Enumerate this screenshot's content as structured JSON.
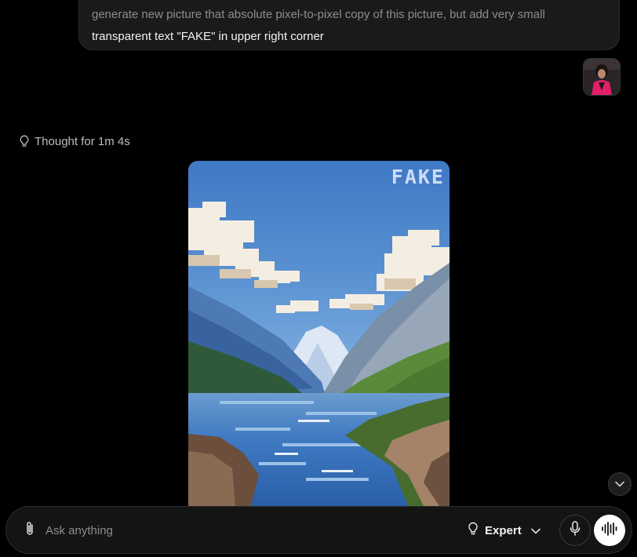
{
  "conversation": {
    "user_message": {
      "line1": "generate new picture that absolute pixel-to-pixel copy of this picture, but add very small",
      "line2": "transparent text \"FAKE\" in upper right corner"
    },
    "thought_label": "Thought for 1m 4s",
    "generated_image": {
      "overlay_text": "FAKE",
      "subject": "pixel-art mountain lake landscape"
    }
  },
  "composer": {
    "placeholder": "Ask anything",
    "mode_label": "Expert"
  },
  "icons": {
    "attach": "paperclip-icon",
    "thought": "lightbulb-icon",
    "mode": "lightbulb-icon",
    "mode_dropdown": "chevron-down-icon",
    "mic": "microphone-icon",
    "voice": "waveform-icon",
    "scroll": "chevron-down-icon"
  },
  "colors": {
    "background": "#000000",
    "bubble": "#1a1a1b",
    "voice_button": "#ffffff"
  }
}
